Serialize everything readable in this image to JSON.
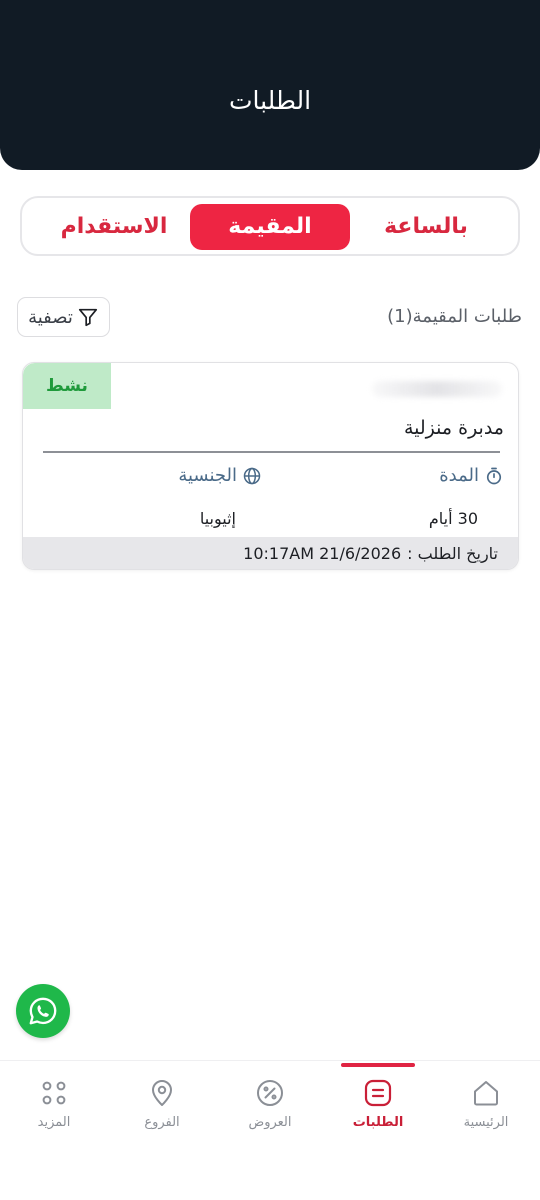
{
  "header": {
    "title": "الطلبات"
  },
  "segments": {
    "hourly": "بالساعة",
    "resident": "المقيمة",
    "recruitment": "الاستقدام",
    "active": "resident"
  },
  "list": {
    "title": "طلبات المقيمة(1)"
  },
  "filter": {
    "label": "تصفية",
    "icon": "filter-icon"
  },
  "orders": [
    {
      "status": "نشط",
      "service": "مدبرة منزلية",
      "duration_label": "المدة",
      "duration_value": "30 أيام",
      "nationality_label": "الجنسية",
      "nationality_value": "إثيوبيا",
      "date_label": "تاريخ الطلب :",
      "date_value": "10:17AM 21/6/2026"
    }
  ],
  "nav": {
    "items": [
      {
        "key": "home",
        "label": "الرئيسية",
        "icon": "home-icon"
      },
      {
        "key": "orders",
        "label": "الطلبات",
        "icon": "orders-icon"
      },
      {
        "key": "offers",
        "label": "العروض",
        "icon": "percent-icon"
      },
      {
        "key": "branches",
        "label": "الفروع",
        "icon": "location-pin-icon"
      },
      {
        "key": "more",
        "label": "المزيد",
        "icon": "grid-dots-icon"
      }
    ],
    "active": "orders"
  },
  "colors": {
    "header_bg": "#111b25",
    "accent": "#ee2543",
    "badge_bg": "#bfeac8",
    "badge_text": "#1f9a3b",
    "whatsapp": "#1fb84a"
  }
}
